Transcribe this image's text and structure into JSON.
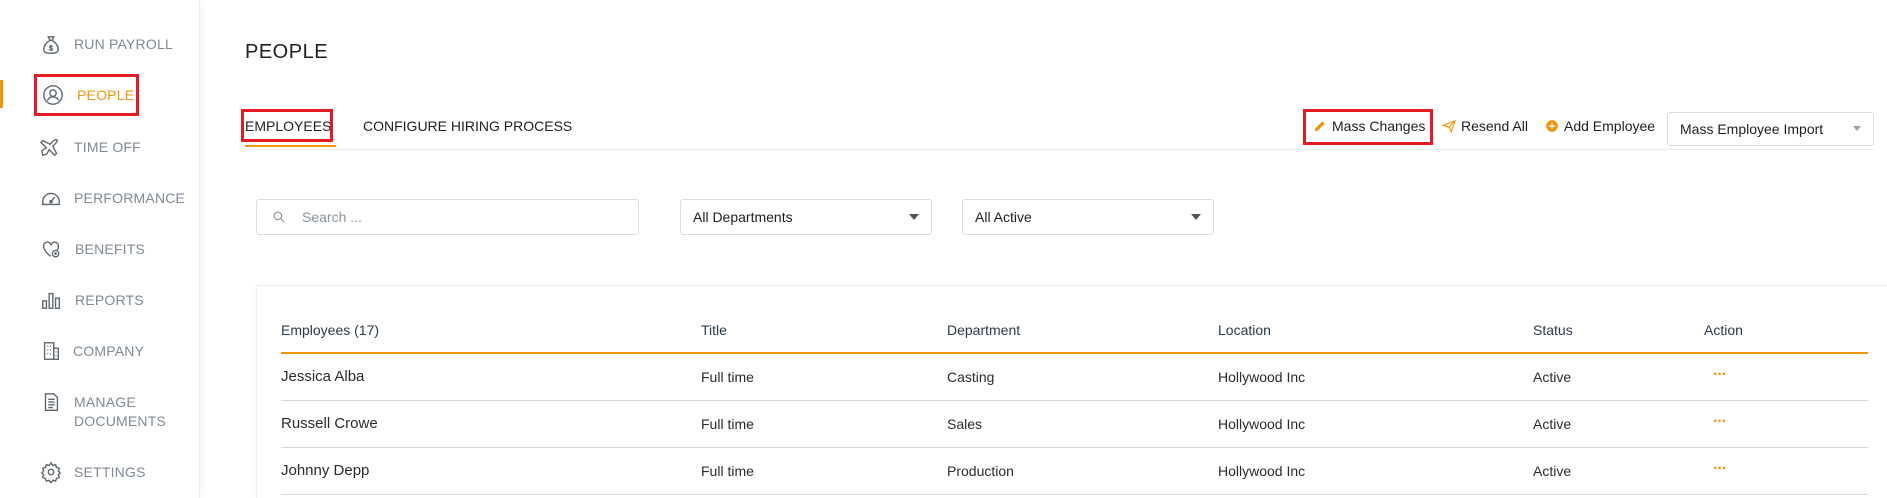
{
  "sidebar": {
    "items": [
      {
        "key": "run-payroll",
        "label": "RUN PAYROLL",
        "icon": "money-bag-icon"
      },
      {
        "key": "people",
        "label": "PEOPLE",
        "icon": "person-circle-icon",
        "active": true
      },
      {
        "key": "time-off",
        "label": "TIME OFF",
        "icon": "airplane-icon"
      },
      {
        "key": "performance",
        "label": "PERFORMANCE",
        "icon": "gauge-icon"
      },
      {
        "key": "benefits",
        "label": "BENEFITS",
        "icon": "heart-plus-icon"
      },
      {
        "key": "reports",
        "label": "REPORTS",
        "icon": "bar-chart-icon"
      },
      {
        "key": "company",
        "label": "COMPANY",
        "icon": "building-icon"
      },
      {
        "key": "manage-documents",
        "label": "MANAGE",
        "label2": "DOCUMENTS",
        "icon": "document-icon"
      },
      {
        "key": "settings",
        "label": "SETTINGS",
        "icon": "gear-icon"
      }
    ]
  },
  "page": {
    "title": "PEOPLE"
  },
  "tabs": [
    {
      "label": "EMPLOYEES",
      "active": true
    },
    {
      "label": "CONFIGURE HIRING PROCESS"
    }
  ],
  "toolbar": {
    "mass_changes": "Mass Changes",
    "resend_all": "Resend All",
    "add_employee": "Add Employee",
    "mass_import": "Mass Employee Import"
  },
  "filters": {
    "search_placeholder": "Search ...",
    "department": "All Departments",
    "status": "All Active"
  },
  "table": {
    "columns": [
      "Employees (17)",
      "Title",
      "Department",
      "Location",
      "Status",
      "Action"
    ],
    "rows": [
      {
        "name": "Jessica Alba",
        "title": "Full time",
        "department": "Casting",
        "location": "Hollywood Inc",
        "status": "Active",
        "action": "···"
      },
      {
        "name": "Russell Crowe",
        "title": "Full time",
        "department": "Sales",
        "location": "Hollywood Inc",
        "status": "Active",
        "action": "···"
      },
      {
        "name": "Johnny Depp",
        "title": "Full time",
        "department": "Production",
        "location": "Hollywood Inc",
        "status": "Active",
        "action": "···"
      }
    ]
  },
  "colors": {
    "accent": "#f2930b",
    "highlight": "#e31b23",
    "nav_text": "#7f8a96"
  }
}
